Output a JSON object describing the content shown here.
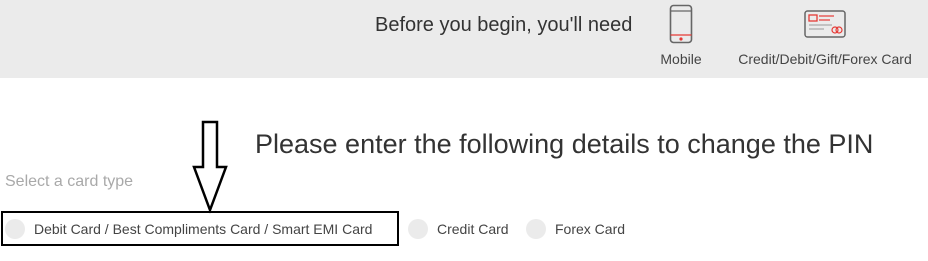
{
  "banner": {
    "title": "Before you begin, you'll need",
    "requirements": [
      {
        "label": "Mobile",
        "icon": "mobile-phone-icon"
      },
      {
        "label": "Credit/Debit/Gift/Forex Card",
        "icon": "card-icon"
      }
    ],
    "accent_color": "#e53935"
  },
  "main": {
    "heading": "Please enter the following details to change the PIN",
    "card_type_label": "Select a card type",
    "card_types": [
      {
        "label": "Debit Card / Best Compliments Card / Smart EMI Card",
        "selected": false
      },
      {
        "label": "Credit Card",
        "selected": false
      },
      {
        "label": "Forex Card",
        "selected": false
      }
    ]
  },
  "annotation": {
    "arrow_icon": "down-arrow-icon",
    "highlight_target": "Debit Card / Best Compliments Card / Smart EMI Card"
  }
}
